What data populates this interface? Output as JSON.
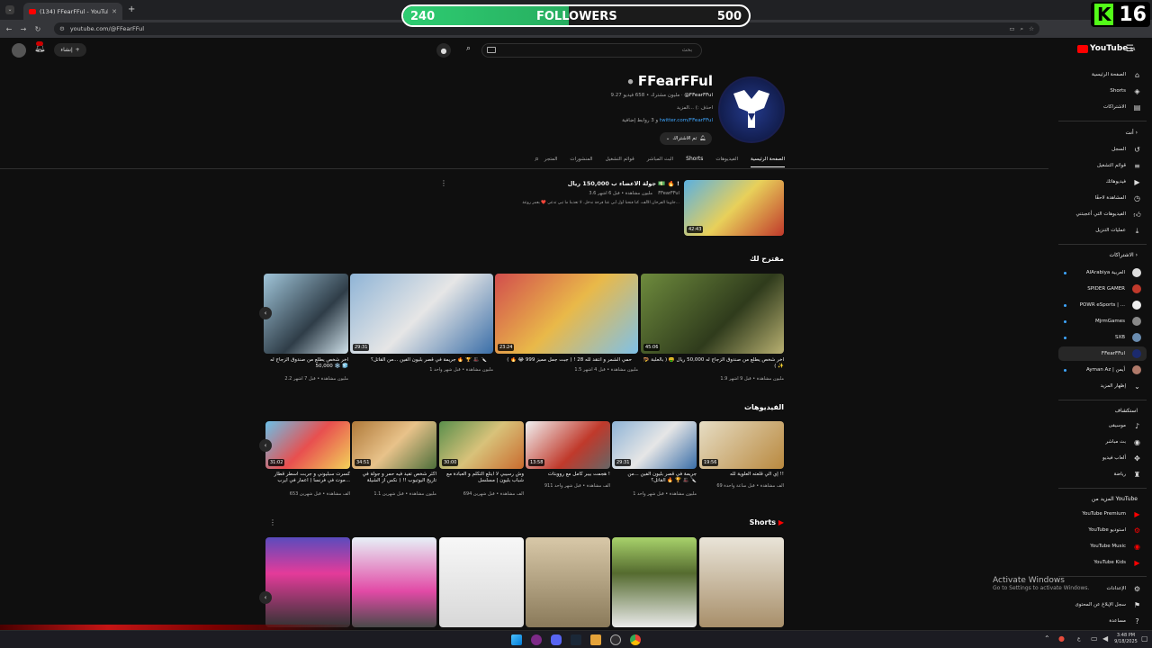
{
  "browser": {
    "tab_title": "(134) FFearFFul - YouTube",
    "new_tab": "+",
    "url": "youtube.com/@FFearFFul"
  },
  "overlay": {
    "followers_current": "240",
    "followers_label": "FOLLOWERS",
    "followers_goal": "500",
    "followers_progress": 0.48,
    "kick_logo": "K",
    "kick_count": "16"
  },
  "youtube": {
    "logo": "YouTube",
    "logo_sup": "SA",
    "search_placeholder": "بحث",
    "create_label": "إنشاء"
  },
  "channel": {
    "name": "FFearFFul",
    "handle": "@FFearFFul",
    "meta": "9.27 مليون مشترك • 658 فيديو",
    "desc": "احذف :) ...المزيد",
    "link": "twitter.com/FFearFFul",
    "links_extra": "و 3 روابط إضافية",
    "subscribe_label": "تم الاشتراك"
  },
  "tabs": [
    "الصفحة الرئيسية",
    "الفيديوهات",
    "Shorts",
    "البث المباشر",
    "قوائم التشغيل",
    "المنشورات",
    "المتجر"
  ],
  "featured": {
    "title": "جولة الأعضاء ب 150,000 ريال 💵 🔥 !",
    "channel": "FFearFFul",
    "meta": "3.6 مليون مشاهدة • قبل 6 أشهر",
    "desc": "جاوبنا الفرحان الألف، كنا فتحنا أول أبي عنا فرحة ندخل. لا تعذبنا ما تبي تدعي ❤️ بعمر روعة...",
    "duration": "42:43"
  },
  "sections": {
    "for_you": "مقترح لك",
    "videos": "الفيديوهات",
    "shorts": "Shorts"
  },
  "for_you_videos": [
    {
      "title": "آخر شخص يطلع من صندوق الزجاج له 50,000 ريال 🤑 ( بالعلبة 🪤 ✨ )",
      "meta": "1.9 مليون مشاهدة • قبل 9 أشهر",
      "duration": "45:06"
    },
    {
      "title": "حمي الشمر و انتقد لله 28 ! ( جبت جمل مميز 999 😂 🔥 )",
      "meta": "1.5 مليون مشاهدة • قبل 4 أشهر",
      "duration": "23:24"
    },
    {
      "title": "جريمة في قصر بليون ألفين ...من القاتل؟ 🔥 🏆 🎩 🔪",
      "meta": "1 مليون مشاهدة • قبل شهر واحد",
      "duration": "29:31"
    },
    {
      "title": "آخر شخص يطلع من صندوق الزجاج له 50,000 ❄️ 🧊",
      "meta": "2.2 مليون مشاهدة • قبل 7 أشهر",
      "duration": ""
    }
  ],
  "videos": [
    {
      "title": "إي الي قلعته العلوية لله !!",
      "meta": "69 ألف مشاهدة • قبل ساعة واحدة",
      "duration": "19:56"
    },
    {
      "title": "جريمة في قصر بليون ألفين ...من القاتل؟ 🔥 🏆 🎩 🔪",
      "meta": "1 مليون مشاهدة • قبل شهر واحد",
      "duration": "29:31"
    },
    {
      "title": "هجمت بيبر كامل مع رووبتات !",
      "meta": "911 ألف مشاهدة • قبل شهر واحد",
      "duration": "13:58"
    },
    {
      "title": "وش رسيبي لا ابتلع التكلم و العبادة مع شباب بليون | مسلسل",
      "meta": "694 ألف مشاهدة • قبل شهرين",
      "duration": "30:00"
    },
    {
      "title": "اكثر شخص تفيد فيه حمر و جولة في تاريخ اليوتيوب !! ( نكس از الشيلة الرائعي",
      "meta": "1.1 مليون مشاهدة • قبل شهرين",
      "duration": "34:51"
    },
    {
      "title": "كسرت سبليوني و جربت اسطر قطار موت في فرنسا ( اعمار في ايرب...",
      "meta": "653 ألف مشاهدة • قبل شهرين",
      "duration": "31:02"
    }
  ],
  "sidebar": {
    "main": [
      "الصفحة الرئيسية",
      "Shorts",
      "الاشتراكات"
    ],
    "you_head": "أنت",
    "you": [
      "السجل",
      "قوائم التشغيل",
      "فيديوهاتك",
      "المشاهدة لاحقًا",
      "الفيديوهات التي أعجبتني",
      "عمليات التنزيل"
    ],
    "subs_head": "الاشتراكات",
    "subs": [
      "AlArabiya العربية",
      "SPIDER GAMER",
      "POWR eSports | ...",
      "MjrmGames",
      "SXB",
      "FFearFFul",
      "Ayman Az | أيمن",
      "إظهار المزيد"
    ],
    "explore_head": "استكشاف",
    "explore": [
      "موسيقى",
      "بث مباشر",
      "ألعاب فيديو",
      "رياضة"
    ],
    "more_head": "المزيد من YouTube",
    "more": [
      "YouTube Premium",
      "YouTube استوديو",
      "YouTube Music",
      "YouTube Kids"
    ],
    "settings": [
      "الإعدادات",
      "سجل الإبلاغ عن المحتوى",
      "مساعدة"
    ]
  },
  "windows": {
    "activate_title": "Activate Windows",
    "activate_sub": "Go to Settings to activate Windows.",
    "time": "3:48 PM",
    "date": "9/18/2025",
    "lang": "ع"
  }
}
